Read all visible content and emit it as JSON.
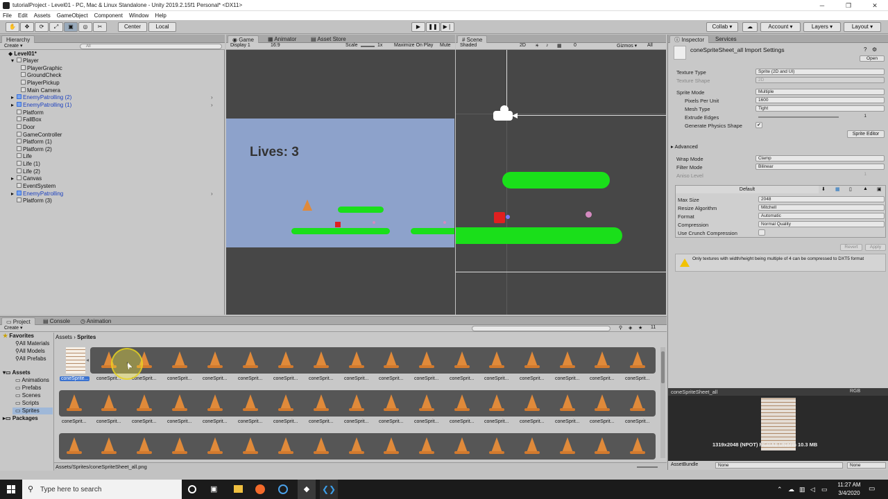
{
  "window": {
    "title": "tutorialProject - Level01 - PC, Mac & Linux Standalone - Unity 2019.2.15f1 Personal* <DX11>",
    "min": "─",
    "max": "❐",
    "close": "✕"
  },
  "menu": [
    "File",
    "Edit",
    "Assets",
    "GameObject",
    "Component",
    "Window",
    "Help"
  ],
  "toolbar": {
    "center": "Center",
    "local": "Local",
    "collab": "Collab ▾",
    "account": "Account ▾",
    "layers": "Layers ▾",
    "layout": "Layout ▾"
  },
  "hierarchy": {
    "tab": "Hierarchy",
    "create": "Create ▾",
    "search": "All",
    "scene": "Level01*",
    "items": [
      {
        "label": "Player",
        "depth": 1,
        "prefab": false,
        "arrow": "▾"
      },
      {
        "label": "PlayerGraphic",
        "depth": 2,
        "prefab": false,
        "arrow": ""
      },
      {
        "label": "GroundCheck",
        "depth": 2,
        "prefab": false,
        "arrow": ""
      },
      {
        "label": "PlayerPickup",
        "depth": 2,
        "prefab": false,
        "arrow": ""
      },
      {
        "label": "Main Camera",
        "depth": 2,
        "prefab": false,
        "arrow": ""
      },
      {
        "label": "EnemyPatrolling (2)",
        "depth": 1,
        "prefab": true,
        "arrow": "▸"
      },
      {
        "label": "EnemyPatrolling (1)",
        "depth": 1,
        "prefab": true,
        "arrow": "▸"
      },
      {
        "label": "Platform",
        "depth": 1,
        "prefab": false,
        "arrow": ""
      },
      {
        "label": "FallBox",
        "depth": 1,
        "prefab": false,
        "arrow": ""
      },
      {
        "label": "Door",
        "depth": 1,
        "prefab": false,
        "arrow": ""
      },
      {
        "label": "GameController",
        "depth": 1,
        "prefab": false,
        "arrow": ""
      },
      {
        "label": "Platform (1)",
        "depth": 1,
        "prefab": false,
        "arrow": ""
      },
      {
        "label": "Platform (2)",
        "depth": 1,
        "prefab": false,
        "arrow": ""
      },
      {
        "label": "Life",
        "depth": 1,
        "prefab": false,
        "arrow": ""
      },
      {
        "label": "Life (1)",
        "depth": 1,
        "prefab": false,
        "arrow": ""
      },
      {
        "label": "Life (2)",
        "depth": 1,
        "prefab": false,
        "arrow": ""
      },
      {
        "label": "Canvas",
        "depth": 1,
        "prefab": false,
        "arrow": "▸"
      },
      {
        "label": "EventSystem",
        "depth": 1,
        "prefab": false,
        "arrow": ""
      },
      {
        "label": "EnemyPatrolling",
        "depth": 1,
        "prefab": true,
        "arrow": "▸"
      },
      {
        "label": "Platform (3)",
        "depth": 1,
        "prefab": false,
        "arrow": ""
      }
    ]
  },
  "game": {
    "tabs": [
      "Game",
      "Animator",
      "Asset Store"
    ],
    "display": "Display 1",
    "aspect": "16:9",
    "scale_label": "Scale",
    "scale_value": "1x",
    "maximize": "Maximize On Play",
    "mute": "Mute",
    "lives": "Lives: 3"
  },
  "scene": {
    "tab": "Scene",
    "shading": "Shaded",
    "mode2d": "2D",
    "gizmos": "Gizmos ▾",
    "search": "All",
    "hidden_count": "0"
  },
  "inspector": {
    "tabs": [
      "Inspector",
      "Services"
    ],
    "title": "coneSpriteSheet_all Import Settings",
    "open": "Open",
    "fields": [
      {
        "label": "Texture Type",
        "value": "Sprite (2D and UI)",
        "dim": false,
        "indent": false
      },
      {
        "label": "Texture Shape",
        "value": "2D",
        "dim": true,
        "indent": false
      },
      {
        "label": "Sprite Mode",
        "value": "Multiple",
        "dim": false,
        "indent": false
      },
      {
        "label": "Pixels Per Unit",
        "value": "1600",
        "dim": false,
        "indent": true
      },
      {
        "label": "Mesh Type",
        "value": "Tight",
        "dim": false,
        "indent": true
      },
      {
        "label": "Extrude Edges",
        "value": "1",
        "dim": false,
        "indent": true
      },
      {
        "label": "Generate Physics Shape",
        "value": "✔",
        "dim": false,
        "indent": true
      }
    ],
    "sprite_editor": "Sprite Editor",
    "advanced": "Advanced",
    "wrap": [
      {
        "label": "Wrap Mode",
        "value": "Clamp",
        "dim": false
      },
      {
        "label": "Filter Mode",
        "value": "Bilinear",
        "dim": false
      },
      {
        "label": "Aniso Level",
        "value": "1",
        "dim": true
      }
    ],
    "platform_tab": "Default",
    "platform": [
      {
        "label": "Max Size",
        "value": "2048"
      },
      {
        "label": "Resize Algorithm",
        "value": "Mitchell"
      },
      {
        "label": "Format",
        "value": "Automatic"
      },
      {
        "label": "Compression",
        "value": "Normal Quality"
      },
      {
        "label": "Use Crunch Compression",
        "value": ""
      }
    ],
    "revert": "Revert",
    "apply": "Apply",
    "warning": "Only textures with width/height being multiple of 4 can be compressed to DXT5 format",
    "preview_title": "coneSpriteSheet_all",
    "preview_rgb": "RGB",
    "preview_info": "1319x2048 (NPOT)  RGBA8 UNorm  10.3 MB",
    "assetbundle": "AssetBundle",
    "ab_value": "None",
    "ab_variant": "None"
  },
  "project": {
    "tabs": [
      "Project",
      "Console",
      "Animation"
    ],
    "create": "Create ▾",
    "favorites": "Favorites",
    "fav_items": [
      "All Materials",
      "All Models",
      "All Prefabs"
    ],
    "assets": "Assets",
    "asset_items": [
      "Animations",
      "Prefabs",
      "Scenes",
      "Scripts",
      "Sprites"
    ],
    "packages": "Packages",
    "breadcrumb_root": "Assets",
    "breadcrumb_sep": "›",
    "breadcrumb_leaf": "Sprites",
    "selected_label": "coneSprite...",
    "sprite_label": "coneSprit...",
    "footer_path": "Assets/Sprites/coneSpriteSheet_all.png",
    "hidden_count": "11"
  },
  "taskbar": {
    "search": "Type here to search",
    "time": "11:27 AM",
    "date": "3/4/2020"
  },
  "colors": {
    "editor_bg": "#c2c2c2",
    "game_sky": "#8da2cb",
    "scene_bg": "#474747",
    "platform": "#1adf1a",
    "cone": "#e08a3a"
  }
}
